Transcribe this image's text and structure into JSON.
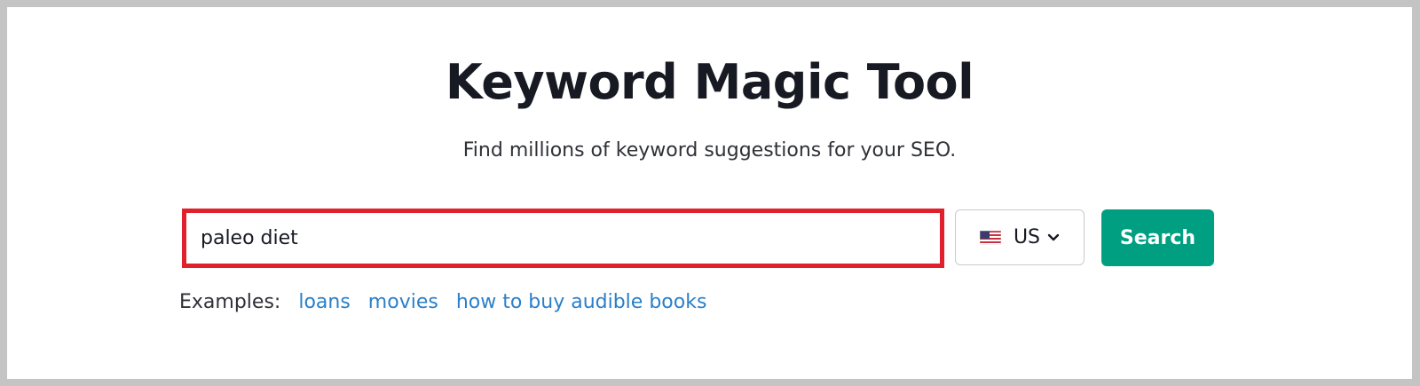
{
  "page": {
    "title": "Keyword Magic Tool",
    "subtitle": "Find millions of keyword suggestions for your SEO."
  },
  "search": {
    "value": "paleo diet",
    "placeholder": ""
  },
  "country_select": {
    "selected": "US",
    "flag_icon": "us-flag-icon",
    "chevron_icon": "chevron-down-icon"
  },
  "search_button": {
    "label": "Search"
  },
  "examples": {
    "label": "Examples:",
    "links": [
      "loans",
      "movies",
      "how to buy audible books"
    ]
  },
  "colors": {
    "background_frame": "#c4c4c4",
    "highlight_border": "#e0202c",
    "search_button": "#009f81",
    "link": "#2b7fc9",
    "title_text": "#171a22"
  }
}
